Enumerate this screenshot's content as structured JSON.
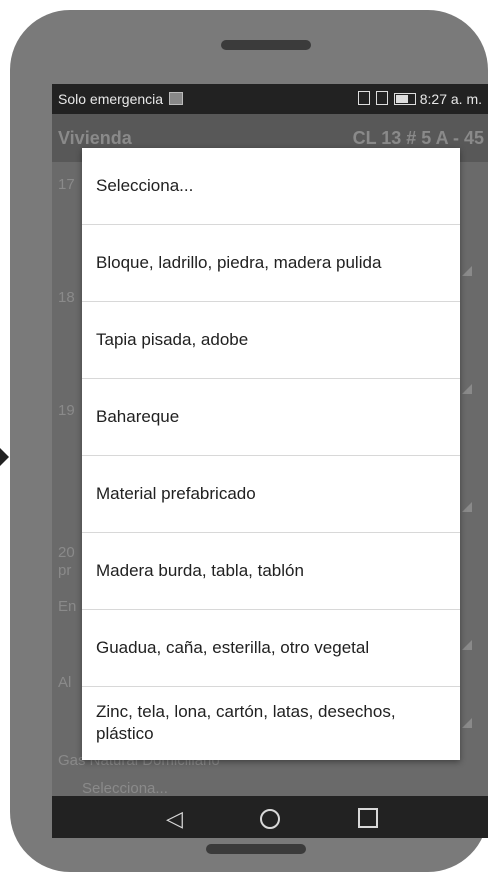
{
  "status_bar": {
    "carrier": "Solo emergencia",
    "time": "8:27 a. m."
  },
  "app_bar": {
    "title": "Vivienda",
    "address": "CL 13 # 5 A - 45"
  },
  "background_form": {
    "labels": [
      "17",
      "18",
      "19",
      "20",
      "pr",
      "En",
      "Al",
      "Gas Natural Domiciliario"
    ],
    "values": [
      "S",
      "S",
      "S",
      "S",
      "S",
      "Selecciona..."
    ]
  },
  "dialog": {
    "options": [
      {
        "label": "Selecciona..."
      },
      {
        "label": "Bloque, ladrillo, piedra, madera pulida"
      },
      {
        "label": "Tapia pisada, adobe"
      },
      {
        "label": "Bahareque"
      },
      {
        "label": "Material prefabricado"
      },
      {
        "label": "Madera burda, tabla, tablón"
      },
      {
        "label": "Guadua, caña, esterilla, otro vegetal"
      },
      {
        "label": "Zinc, tela, lona, cartón, latas, desechos, plástico"
      }
    ]
  },
  "icons": [
    "sim-icon",
    "vibrate-icon",
    "rotate-icon",
    "battery-icon",
    "back-icon",
    "home-icon",
    "recents-icon"
  ]
}
